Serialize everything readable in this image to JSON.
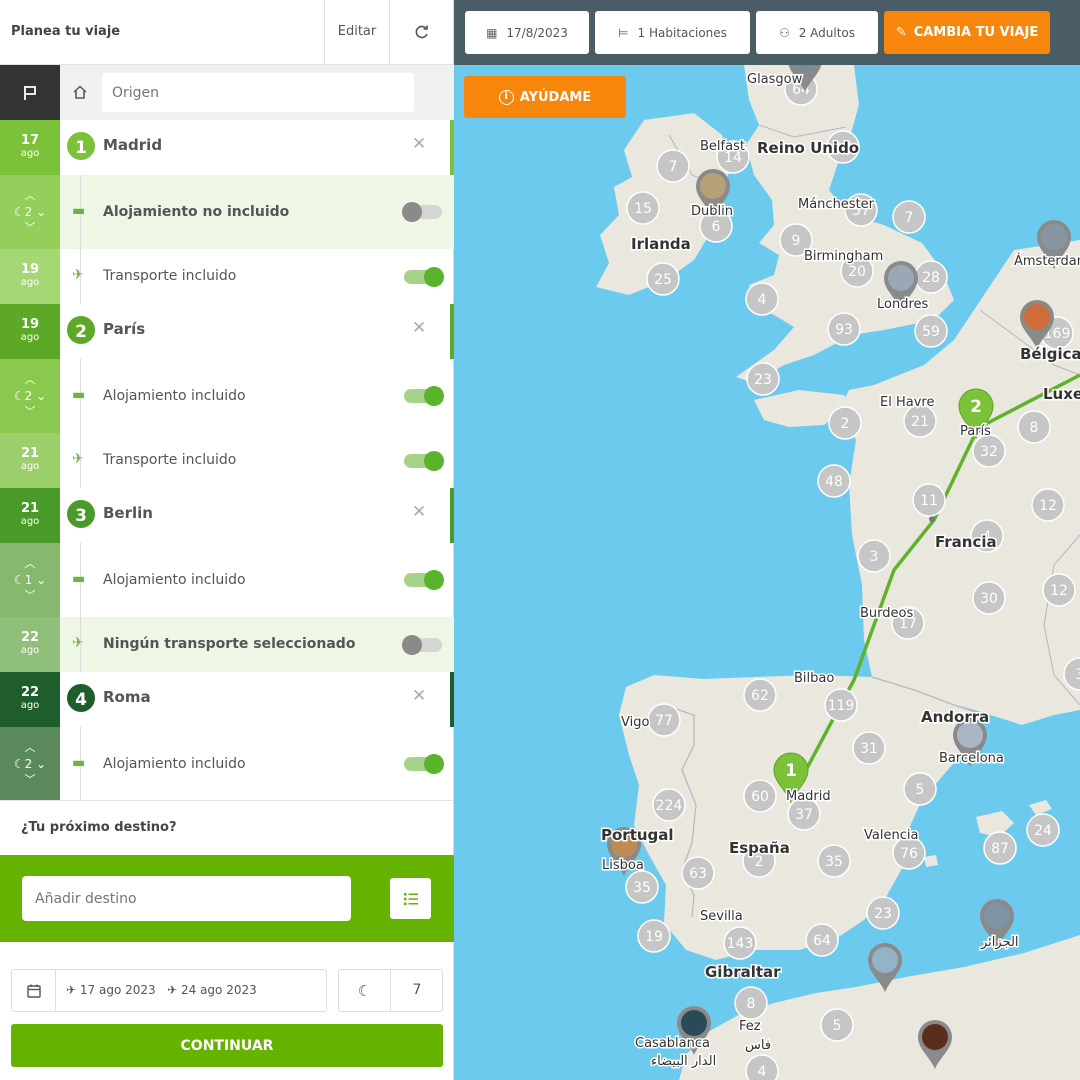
{
  "header": {
    "title": "Planea tu viaje",
    "edit_label": "Editar",
    "refresh_icon": "refresh-icon"
  },
  "origin": {
    "placeholder": "Origen"
  },
  "itinerary": [
    {
      "kind": "city",
      "day": "17",
      "month": "ago",
      "number": "1",
      "name": "Madrid"
    },
    {
      "kind": "stay",
      "nights": "2",
      "text": "Alojamiento no incluido",
      "enabled": false
    },
    {
      "kind": "transport",
      "day": "19",
      "month": "ago",
      "text": "Transporte incluido",
      "enabled": true
    },
    {
      "kind": "city",
      "day": "19",
      "month": "ago",
      "number": "2",
      "name": "París"
    },
    {
      "kind": "stay",
      "nights": "2",
      "text": "Alojamiento incluido",
      "enabled": true
    },
    {
      "kind": "transport",
      "day": "21",
      "month": "ago",
      "text": "Transporte incluido",
      "enabled": true
    },
    {
      "kind": "city",
      "day": "21",
      "month": "ago",
      "number": "3",
      "name": "Berlin"
    },
    {
      "kind": "stay",
      "nights": "1",
      "text": "Alojamiento incluido",
      "enabled": true
    },
    {
      "kind": "transport",
      "day": "22",
      "month": "ago",
      "text": "Ningún transporte seleccionado",
      "enabled": false
    },
    {
      "kind": "city",
      "day": "22",
      "month": "ago",
      "number": "4",
      "name": "Roma"
    },
    {
      "kind": "stay",
      "nights": "2",
      "text": "Alojamiento incluido",
      "enabled": true
    }
  ],
  "next_destination": {
    "label": "¿Tu próximo destino?",
    "add_placeholder": "Añadir destino"
  },
  "summary": {
    "start_date": "17 ago 2023",
    "end_date": "24 ago 2023",
    "nights": "7"
  },
  "continue_label": "CONTINUAR",
  "map_toolbar": {
    "date": "17/8/2023",
    "rooms": "1 Habitaciones",
    "adults": "2 Adultos",
    "cambia": "CAMBIA TU VIAJE",
    "ayudame": "AYÚDAME"
  },
  "map": {
    "route_pins": [
      {
        "number": "1",
        "city": "Madrid"
      },
      {
        "number": "2",
        "city": "París"
      }
    ],
    "place_labels": [
      {
        "text": "Glasgow",
        "bold": false
      },
      {
        "text": "Belfast",
        "bold": false
      },
      {
        "text": "Reino Unido",
        "bold": true
      },
      {
        "text": "Dublin",
        "bold": false
      },
      {
        "text": "Mánchester",
        "bold": false
      },
      {
        "text": "Irlanda",
        "bold": true
      },
      {
        "text": "Birmingham",
        "bold": false
      },
      {
        "text": "Londres",
        "bold": false
      },
      {
        "text": "Ámsterdam",
        "bold": false
      },
      {
        "text": "Bélgica",
        "bold": true
      },
      {
        "text": "Luxemburgo",
        "bold": true
      },
      {
        "text": "El Havre",
        "bold": false
      },
      {
        "text": "París",
        "bold": false
      },
      {
        "text": "Francia",
        "bold": true
      },
      {
        "text": "Burdeos",
        "bold": false
      },
      {
        "text": "Bilbao",
        "bold": false
      },
      {
        "text": "Andorra",
        "bold": true
      },
      {
        "text": "Vigo",
        "bold": false
      },
      {
        "text": "Barcelona",
        "bold": false
      },
      {
        "text": "Madrid",
        "bold": false
      },
      {
        "text": "Portugal",
        "bold": true
      },
      {
        "text": "España",
        "bold": true
      },
      {
        "text": "Valencia",
        "bold": false
      },
      {
        "text": "Lisboa",
        "bold": false
      },
      {
        "text": "Sevilla",
        "bold": false
      },
      {
        "text": "Gibraltar",
        "bold": true
      },
      {
        "text": "Fez",
        "bold": false
      },
      {
        "text": "Casablanca",
        "bold": false
      },
      {
        "text": "الدار البيضاء",
        "bold": false
      },
      {
        "text": "فاس",
        "bold": false
      },
      {
        "text": "الجزائر",
        "bold": false
      }
    ],
    "clusters": [
      "64",
      "17",
      "7",
      "14",
      "15",
      "6",
      "57",
      "7",
      "9",
      "20",
      "28",
      "25",
      "4",
      "93",
      "59",
      "23",
      "169",
      "2",
      "21",
      "8",
      "32",
      "48",
      "11",
      "12",
      "3",
      "4",
      "17",
      "30",
      "12",
      "62",
      "119",
      "77",
      "31",
      "60",
      "37",
      "5",
      "224",
      "24",
      "87",
      "76",
      "35",
      "63",
      "2",
      "35",
      "23",
      "64",
      "19",
      "143",
      "8",
      "5",
      "4",
      "3"
    ],
    "colors": {
      "sea": "#6ccaef",
      "land": "#eae7de",
      "route": "#5fb32c",
      "cluster": "#c6c6c6"
    }
  },
  "colors": {
    "green": "#65b300",
    "orange": "#f7870c",
    "dark": "#333333"
  }
}
